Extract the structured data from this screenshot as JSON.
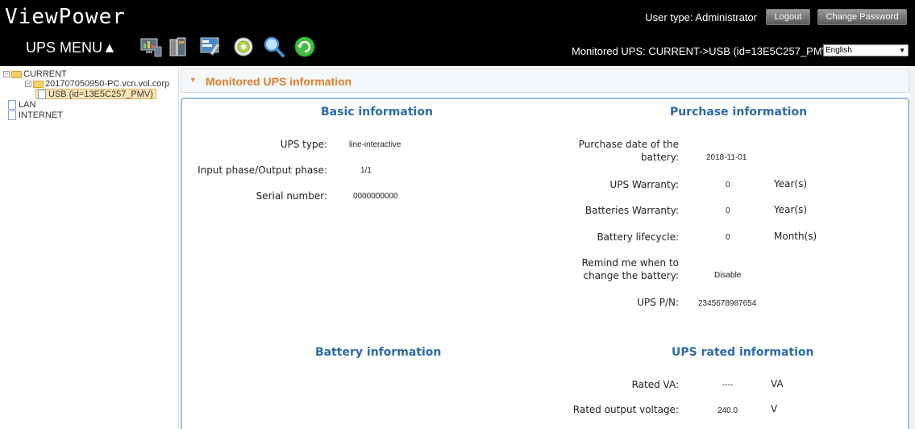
{
  "header": {
    "app_title": "ViewPower",
    "menu_label": "UPS MENU▲",
    "user_type": "User type: Administrator",
    "logout_label": "Logout",
    "change_password_label": "Change Password",
    "monitored_ups": "Monitored UPS: CURRENT->USB (id=13E5C257_PMV)",
    "language": "English",
    "toolbar_icons": [
      "monitor-chart-icon",
      "ups-device-icon",
      "settings-tools-icon",
      "gear-icon",
      "search-icon",
      "refresh-icon"
    ]
  },
  "tree": {
    "root": "CURRENT",
    "pc": "201707050950-PC.vcn.vol.corp",
    "usb": "USB (id=13E5C257_PMV)",
    "lan": "LAN",
    "internet": "INTERNET",
    "toggle_symbol": "⊟"
  },
  "panel": {
    "title": "Monitored UPS information"
  },
  "basic": {
    "title": "Basic information",
    "ups_type_label": "UPS type:",
    "ups_type": "line-interactive",
    "phase_label": "Input phase/Output phase:",
    "phase": "1/1",
    "serial_label": "Serial number:",
    "serial": "0000000000"
  },
  "purchase": {
    "title": "Purchase information",
    "purchase_date_label": "Purchase date of the battery:",
    "purchase_date": "2018-11-01",
    "ups_warranty_label": "UPS Warranty:",
    "ups_warranty": "0",
    "ups_warranty_unit": "Year(s)",
    "battery_warranty_label": "Batteries Warranty:",
    "battery_warranty": "0",
    "battery_warranty_unit": "Year(s)",
    "lifecycle_label": "Battery lifecycle:",
    "lifecycle": "0",
    "lifecycle_unit": "Month(s)",
    "remind_label": "Remind me when to change the battery:",
    "remind": "Disable",
    "pn_label": "UPS P/N:",
    "pn": "2345678987654"
  },
  "battery": {
    "title": "Battery information"
  },
  "rated": {
    "title": "UPS rated information",
    "va_label": "Rated VA:",
    "va": "----",
    "va_unit": "VA",
    "voltage_label": "Rated output voltage:",
    "voltage": "240.0",
    "voltage_unit": "V"
  },
  "colors": {
    "header_bg": "#000000",
    "section_title": "#2b6aa8",
    "panel_title": "#e07d2a",
    "content_border": "#9cc1e3"
  }
}
